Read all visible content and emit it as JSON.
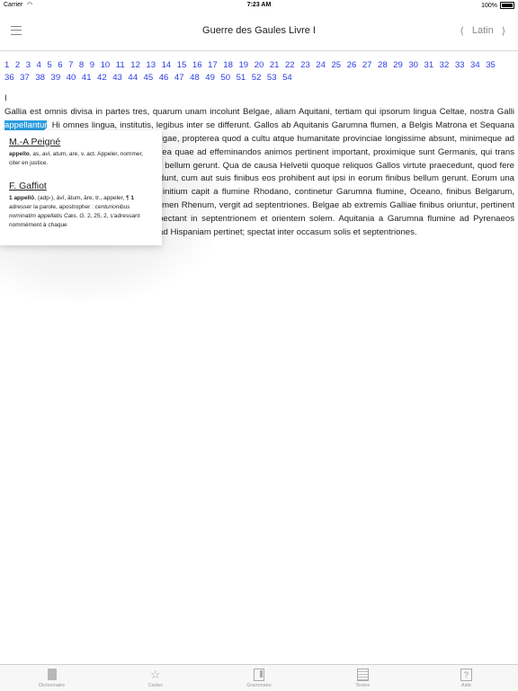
{
  "status": {
    "carrier": "Carrier",
    "time": "7:23 AM",
    "battery": "100%"
  },
  "nav": {
    "title": "Guerre des Gaules Livre I",
    "prev": "⟨",
    "language": "Latin",
    "next": "⟩"
  },
  "chapters": [
    "1",
    "2",
    "3",
    "4",
    "5",
    "6",
    "7",
    "8",
    "9",
    "10",
    "11",
    "12",
    "13",
    "14",
    "15",
    "16",
    "17",
    "18",
    "19",
    "20",
    "21",
    "22",
    "23",
    "24",
    "25",
    "26",
    "27",
    "28",
    "29",
    "30",
    "31",
    "32",
    "33",
    "34",
    "35",
    "36",
    "37",
    "38",
    "39",
    "40",
    "41",
    "42",
    "43",
    "44",
    "45",
    "46",
    "47",
    "48",
    "49",
    "50",
    "51",
    "52",
    "53",
    "54"
  ],
  "text": {
    "roman": "I",
    "before": "Gallia est omnis divisa in partes tres, quarum unam incolunt Belgae, aliam Aquitani, tertiam qui ipsorum lingua Celtae, nostra Galli ",
    "selected": "appellantur",
    "after": ". Hi omnes lingua, institutis, legibus inter se differunt. Gallos ab Aquitanis Garumna flumen, a Belgis Matrona et Sequana dividit. Horum omnium fortissimi sunt Belgae, propterea quod a cultu atque humanitate provinciae longissime absunt, minimeque ad eos mercatores saepe commeant atque ea quae ad effeminandos animos pertinent important, proximique sunt Germanis, qui trans Rhenum incolunt, quibuscum continenter bellum gerunt. Qua de causa Helvetii quoque reliquos Gallos virtute praecedunt, quod fere cotidianis proeliis cum Germanis contendunt, cum aut suis finibus eos prohibent aut ipsi in eorum finibus bellum gerunt. Eorum una pars, quam Gallos obtinere dictum est, initium capit a flumine Rhodano, continetur Garumna flumine, Oceano, finibus Belgarum, attingit etiam ab Sequanis et Helvetiis flumen Rhenum, vergit ad septentriones. Belgae ab extremis Galliae finibus oriuntur, pertinent ad inferiorem partem fluminis Rheni, spectant in septentrionem et orientem solem. Aquitania a Garumna flumine ad Pyrenaeos montes et eam partem Oceani quae est ad Hispaniam pertinet; spectat inter occasum solis et septentriones."
  },
  "popup": {
    "dict1": {
      "title": "M.-A Peigné",
      "headword": "appello",
      "body": ", as, avi, atum, are, v. act. Appeler, nommer, citer en justice."
    },
    "dict2": {
      "title": "F. Gaffiot",
      "num": "1",
      "headword": "appellō",
      "body1": ", (adp-), āvī, ātum, āre, tr., appeler, ¶ ",
      "sense": "1",
      "body2": " adresser la parole, apostropher : ",
      "example": "centurionibus nominatim appellatis Cæs. G.",
      "ref": " 2, 25, 2, s'adressant nommément à chaque"
    }
  },
  "tabs": [
    {
      "label": "Dictionnaire",
      "icon": "book-icon"
    },
    {
      "label": "Cartes",
      "icon": "star-icon"
    },
    {
      "label": "Grammaire",
      "icon": "grammar-icon"
    },
    {
      "label": "Textes",
      "icon": "text-icon"
    },
    {
      "label": "Aide",
      "icon": "help-icon"
    }
  ]
}
